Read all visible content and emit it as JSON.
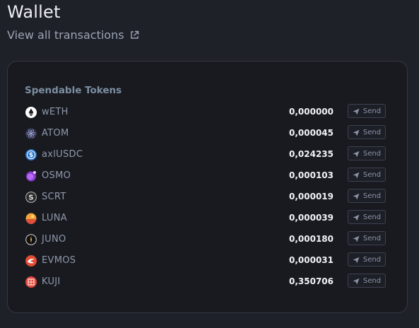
{
  "header": {
    "title": "Wallet",
    "view_all_label": "View all transactions",
    "link_icon": "external-link-icon"
  },
  "tokens_section": {
    "title": "Spendable Tokens",
    "send_label": "Send",
    "tokens": [
      {
        "name": "wETH",
        "amount": "0,000000",
        "icon": "weth-icon",
        "color": "#ffffff"
      },
      {
        "name": "ATOM",
        "amount": "0,000045",
        "icon": "atom-icon",
        "color": "#2e3148"
      },
      {
        "name": "axlUSDC",
        "amount": "0,024235",
        "icon": "usdc-icon",
        "color": "#2775ca"
      },
      {
        "name": "OSMO",
        "amount": "0,000103",
        "icon": "osmo-icon",
        "color": "#8a3bd0"
      },
      {
        "name": "SCRT",
        "amount": "0,000019",
        "icon": "scrt-icon",
        "color": "#2b2b2b"
      },
      {
        "name": "LUNA",
        "amount": "0,000039",
        "icon": "luna-icon",
        "color": "#f0a33a"
      },
      {
        "name": "JUNO",
        "amount": "0,000180",
        "icon": "juno-icon",
        "color": "#111111"
      },
      {
        "name": "EVMOS",
        "amount": "0,000031",
        "icon": "evmos-icon",
        "color": "#e24c34"
      },
      {
        "name": "KUJI",
        "amount": "0,350706",
        "icon": "kuji-icon",
        "color": "#e5483c"
      }
    ]
  }
}
